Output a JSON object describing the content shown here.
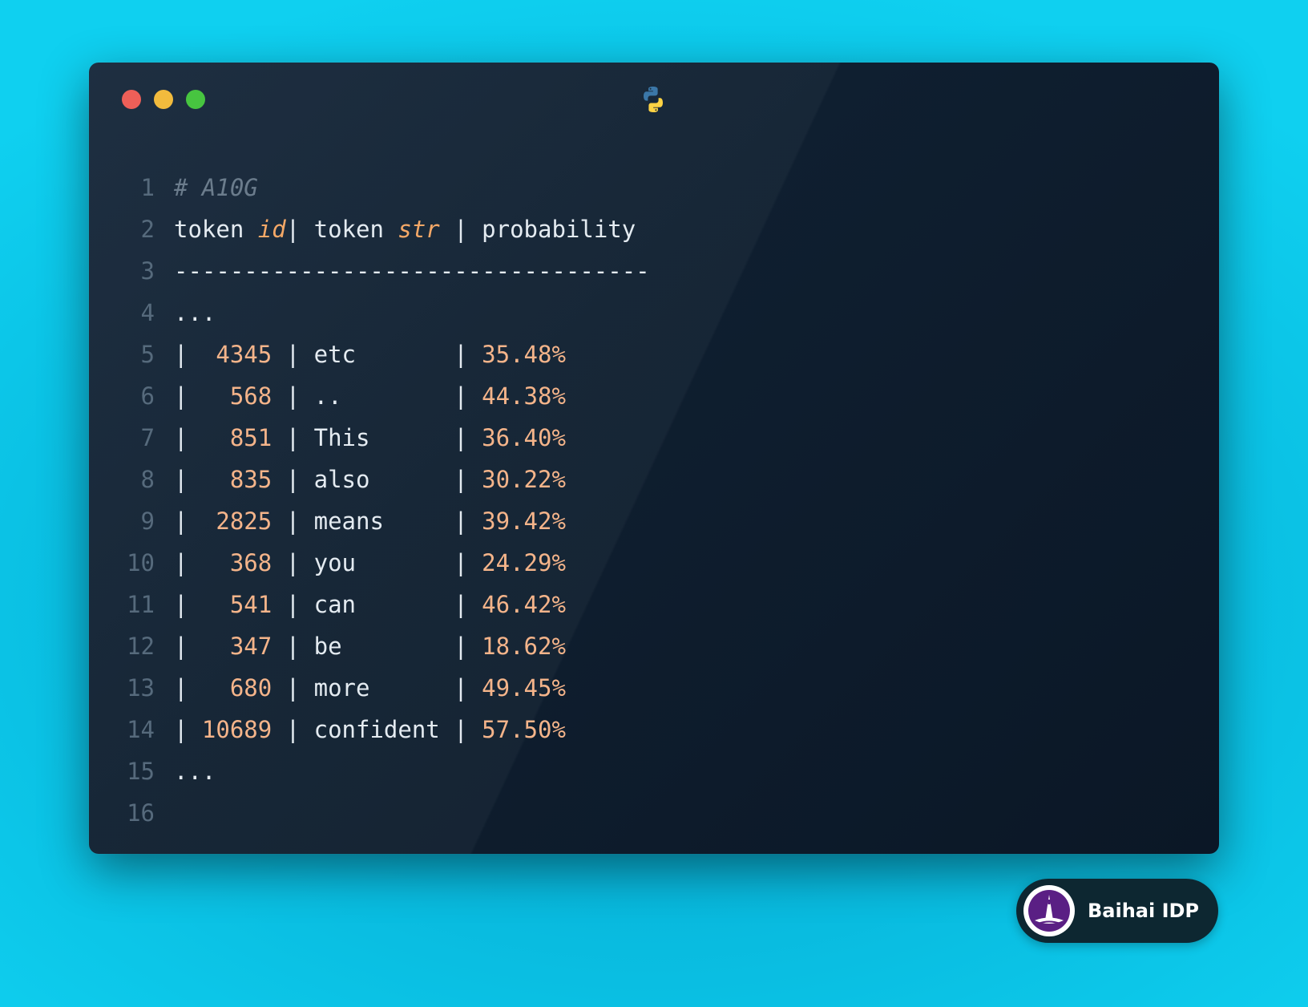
{
  "window": {
    "controls": [
      "close",
      "minimize",
      "maximize"
    ],
    "language_icon": "python-icon"
  },
  "code_lines": [
    {
      "n": "1",
      "comment": "# A10G"
    },
    {
      "n": "2",
      "header": {
        "a": "token ",
        "a_kw": "id",
        "b": "| token ",
        "b_kw": "str",
        "c": " | probability"
      }
    },
    {
      "n": "3",
      "text": "----------------------------------"
    },
    {
      "n": "4",
      "text": "..."
    },
    {
      "n": "5",
      "row": {
        "id": "4345",
        "tok": "etc",
        "prob": "35.48%"
      }
    },
    {
      "n": "6",
      "row": {
        "id": "568",
        "tok": "..",
        "prob": "44.38%"
      }
    },
    {
      "n": "7",
      "row": {
        "id": "851",
        "tok": "This",
        "prob": "36.40%"
      }
    },
    {
      "n": "8",
      "row": {
        "id": "835",
        "tok": "also",
        "prob": "30.22%"
      }
    },
    {
      "n": "9",
      "row": {
        "id": "2825",
        "tok": "means",
        "prob": "39.42%"
      }
    },
    {
      "n": "10",
      "row": {
        "id": "368",
        "tok": "you",
        "prob": "24.29%"
      }
    },
    {
      "n": "11",
      "row": {
        "id": "541",
        "tok": "can",
        "prob": "46.42%"
      }
    },
    {
      "n": "12",
      "row": {
        "id": "347",
        "tok": "be",
        "prob": "18.62%"
      }
    },
    {
      "n": "13",
      "row": {
        "id": "680",
        "tok": "more",
        "prob": "49.45%"
      }
    },
    {
      "n": "14",
      "row": {
        "id": "10689",
        "tok": "confident",
        "prob": "57.50%"
      }
    },
    {
      "n": "15",
      "text": "..."
    },
    {
      "n": "16",
      "text": ""
    }
  ],
  "badge": {
    "label": "Baihai IDP",
    "logo": "baihai-logo-icon"
  },
  "colors": {
    "close": "#ee5f58",
    "minimize": "#f2bb3d",
    "maximize": "#47c540",
    "number": "#f4b48a",
    "keyword": "#f4a867",
    "comment": "#6b7c8c",
    "text": "#e4ebf1"
  }
}
